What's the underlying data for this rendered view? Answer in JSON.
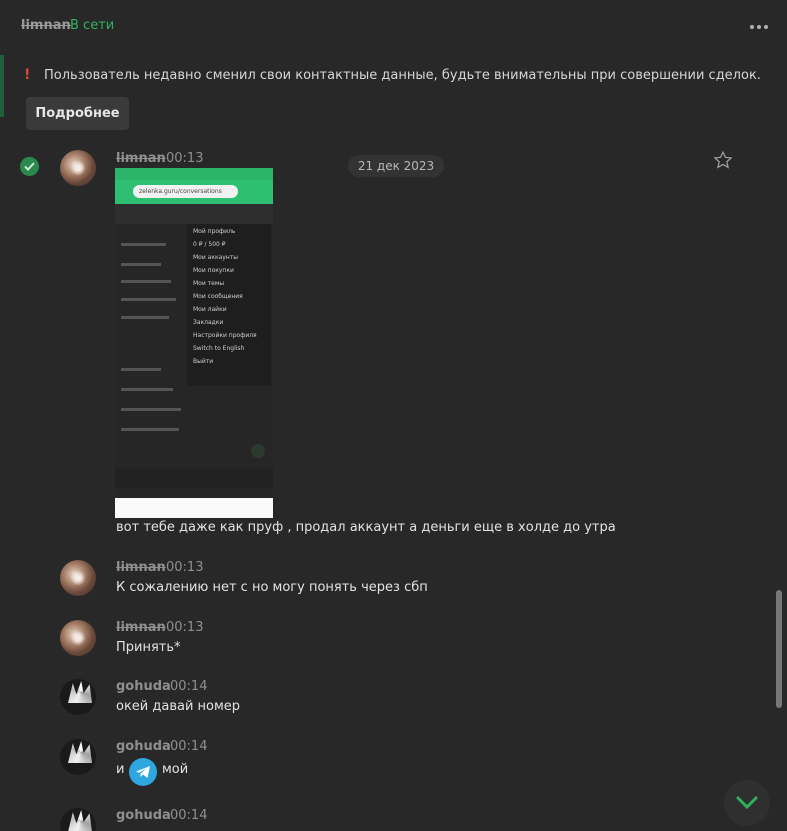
{
  "header": {
    "username": "limnan",
    "status": "В сети"
  },
  "warning": {
    "icon": "exclamation-icon",
    "text": "Пользователь недавно сменил свои контактные данные, будьте внимательны при совершении сделок.",
    "button_label": "Подробнее"
  },
  "date_divider": "21 дек 2023",
  "screenshot": {
    "url": "zelenka.guru/conversations",
    "menu_items": [
      "Мой профиль",
      "0 ₽ / 500 ₽",
      "Мои аккаунты",
      "Мои покупки",
      "Мои темы",
      "Мои сообщения",
      "Мои лайки",
      "Закладки",
      "Настройки профиля",
      "Switch to English",
      "Выйти"
    ]
  },
  "messages": [
    {
      "author": "limnan",
      "time": "00:13",
      "text": "вот тебе даже как пруф , продал аккаунт а деньги еще в холде до утра"
    },
    {
      "author": "limnan",
      "time": "00:13",
      "text": "К сожалению нет с но могу понять через сбп"
    },
    {
      "author": "limnan",
      "time": "00:13",
      "text": "Принять*"
    },
    {
      "author": "gohuda",
      "time": "00:14",
      "text": "окей давай номер"
    },
    {
      "author": "gohuda",
      "time": "00:14",
      "text_before": "и",
      "text_after": "мой"
    },
    {
      "author": "gohuda",
      "time": "00:14",
      "text": ""
    }
  ],
  "colors": {
    "background": "#282828",
    "accent_green": "#2db35d",
    "warning_red": "#e0453a",
    "telegram_blue": "#2ea6e0"
  }
}
